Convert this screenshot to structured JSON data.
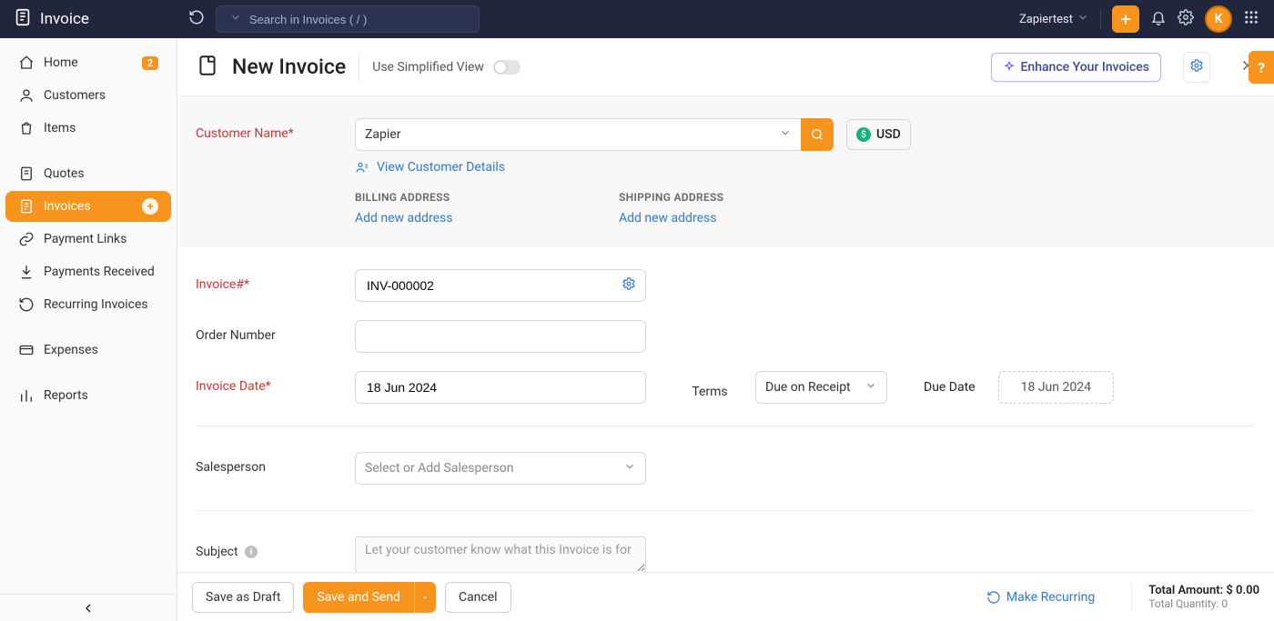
{
  "brand": "Invoice",
  "search": {
    "placeholder": "Search in Invoices ( / )"
  },
  "org": {
    "name": "Zapiertest"
  },
  "avatar_letter": "K",
  "sidebar": [
    {
      "label": "Home",
      "icon": "home",
      "badge": "2"
    },
    {
      "label": "Customers",
      "icon": "user"
    },
    {
      "label": "Items",
      "icon": "bag"
    },
    {
      "gap": true
    },
    {
      "label": "Quotes",
      "icon": "doc"
    },
    {
      "label": "Invoices",
      "icon": "invoice",
      "active": true,
      "plus": true
    },
    {
      "label": "Payment Links",
      "icon": "link"
    },
    {
      "label": "Payments Received",
      "icon": "download"
    },
    {
      "label": "Recurring Invoices",
      "icon": "recur"
    },
    {
      "gap": true
    },
    {
      "label": "Expenses",
      "icon": "wallet"
    },
    {
      "gap": true
    },
    {
      "label": "Reports",
      "icon": "chart"
    }
  ],
  "header": {
    "title": "New Invoice",
    "simplified_label": "Use Simplified View",
    "enhance_label": "Enhance Your Invoices"
  },
  "form": {
    "customer_label": "Customer Name*",
    "customer_value": "Zapier",
    "view_customer": "View Customer Details",
    "currency": "USD",
    "billing_heading": "BILLING ADDRESS",
    "shipping_heading": "SHIPPING ADDRESS",
    "add_address": "Add new address",
    "invoice_no_label": "Invoice#*",
    "invoice_no_value": "INV-000002",
    "order_no_label": "Order Number",
    "order_no_value": "",
    "invoice_date_label": "Invoice Date*",
    "invoice_date_value": "18 Jun 2024",
    "terms_label": "Terms",
    "terms_value": "Due on Receipt",
    "due_date_label": "Due Date",
    "due_date_value": "18 Jun 2024",
    "salesperson_label": "Salesperson",
    "salesperson_placeholder": "Select or Add Salesperson",
    "subject_label": "Subject",
    "subject_placeholder": "Let your customer know what this Invoice is for"
  },
  "footer": {
    "save_draft": "Save as Draft",
    "save_send": "Save and Send",
    "cancel": "Cancel",
    "make_recurring": "Make Recurring",
    "total_amount_label": "Total Amount: ",
    "total_amount_value": "$ 0.00",
    "total_qty_label": "Total Quantity: ",
    "total_qty_value": "0"
  },
  "help": "?"
}
